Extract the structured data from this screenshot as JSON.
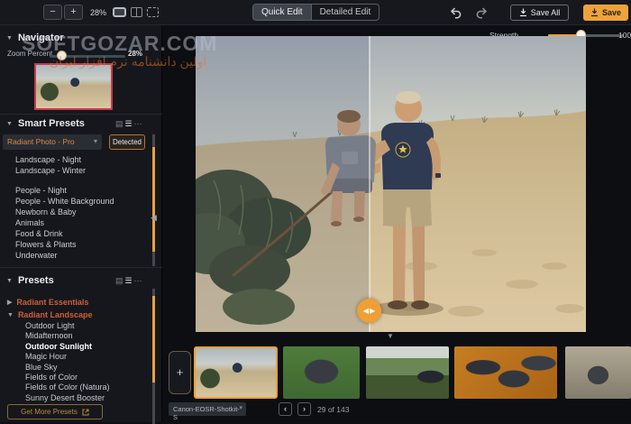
{
  "watermark": {
    "line1": "SOFTGOZAR.COM",
    "line2": "اولین دانشنامه نرم افزار ایران"
  },
  "icons": {
    "collapse": "▼",
    "expand": "▶",
    "panel_collapse": "◀",
    "chevron_down": "▾",
    "more": "⋯",
    "grid_view": "▤",
    "list_view": "☰",
    "split_left": "◀",
    "split_right": "▶",
    "prev": "‹",
    "next": "›",
    "add": "+",
    "zoom_out": "−",
    "zoom_in": "+",
    "filmstrip_collapse": "▼"
  },
  "toolbar": {
    "zoom_value": "28%",
    "quick_edit": "Quick Edit",
    "detailed_edit": "Detailed Edit",
    "save_all": "Save All",
    "save": "Save"
  },
  "sidebar": {
    "navigator": {
      "title": "Navigator",
      "zoom_label": "Zoom Percent",
      "zoom_value": "28%"
    },
    "smart_presets": {
      "title": "Smart Presets",
      "dropdown_value": "Radiant Photo - Pro",
      "detected_label": "Detected",
      "items_a": [
        "Landscape - Night",
        "Landscape - Winter"
      ],
      "items_b": [
        "People - Night",
        "People - White Background",
        "Newborn & Baby",
        "Animals",
        "Food & Drink",
        "Flowers & Plants",
        "Underwater"
      ]
    },
    "presets": {
      "title": "Presets",
      "groups": [
        "Radiant Essentials",
        "Radiant Landscape"
      ],
      "items": [
        "Outdoor Light",
        "Midafternoon",
        "Outdoor Sunlight",
        "Magic Hour",
        "Blue Sky",
        "Fields of Color",
        "Fields of Color (Natura)",
        "Sunny Desert Booster"
      ],
      "selected": "Outdoor Sunlight",
      "get_more_label": "Get More Presets"
    }
  },
  "main": {
    "strength_label": "Strength",
    "strength_value": "100"
  },
  "statusbar": {
    "folder_value": "Canon-EOSR-Shotkit-S",
    "position": "29 of 143"
  },
  "colors": {
    "accent": "#efa23b",
    "radiant_text": "#e08a3c",
    "group_text": "#cf5f35",
    "navigator_border": "#c43b4e"
  }
}
